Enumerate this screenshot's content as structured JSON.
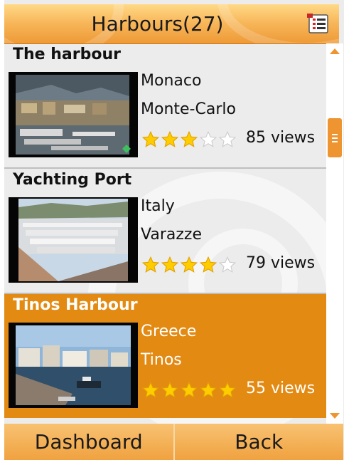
{
  "header": {
    "title": "Harbours(27)",
    "menu_icon": "list-menu-icon"
  },
  "items": [
    {
      "name": "The harbour",
      "country": "Monaco",
      "city": "Monte-Carlo",
      "rating": 3,
      "max_rating": 5,
      "views": "85 views"
    },
    {
      "name": "Yachting Port",
      "country": "Italy",
      "city": "Varazze",
      "rating": 4,
      "max_rating": 5,
      "views": "79 views"
    },
    {
      "name": "Tinos Harbour",
      "country": "Greece",
      "city": "Tinos",
      "rating": 5,
      "max_rating": 5,
      "views": "55 views",
      "selected": true
    }
  ],
  "softkeys": {
    "left": "Dashboard",
    "right": "Back"
  },
  "colors": {
    "accent": "#e38a13",
    "star_filled": "#ffcc00",
    "star_empty": "#ffffff"
  },
  "scroll": {
    "position": 0.15
  }
}
